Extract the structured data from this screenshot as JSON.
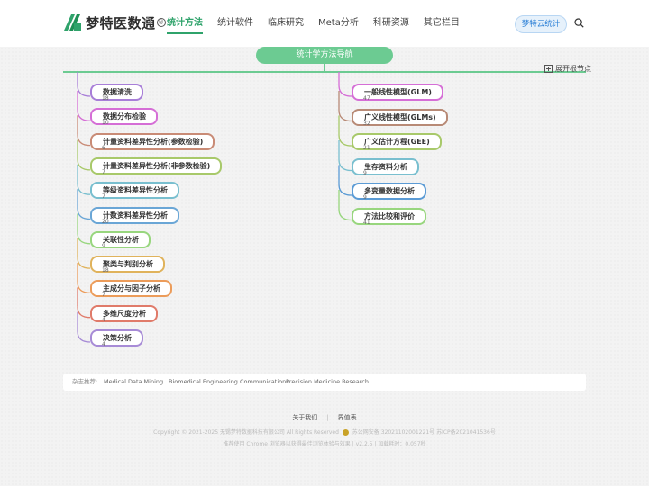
{
  "header": {
    "logo_text": "梦特医数通",
    "logo_mark": "®",
    "nav": [
      {
        "label": "统计方法",
        "active": true
      },
      {
        "label": "统计软件",
        "active": false
      },
      {
        "label": "临床研究",
        "active": false
      },
      {
        "label": "Meta分析",
        "active": false
      },
      {
        "label": "科研资源",
        "active": false
      },
      {
        "label": "其它栏目",
        "active": false
      }
    ],
    "cloud_button": "梦特云统计",
    "icons": [
      "logo-icon",
      "home-icon",
      "search-icon"
    ]
  },
  "mindmap": {
    "root": "统计学方法导航",
    "expand_label": "展开根节点",
    "left": [
      {
        "label": "数据清洗",
        "count": "18",
        "color": "#a87ed8"
      },
      {
        "label": "数据分布检验",
        "count": "10",
        "color": "#d56ed6"
      },
      {
        "label": "计量资料差异性分析(参数检验)",
        "count": "6",
        "color": "#c98b76"
      },
      {
        "label": "计量资料差异性分析(非参数检验)",
        "count": "7",
        "color": "#a8c96a"
      },
      {
        "label": "等级资料差异性分析",
        "count": "7",
        "color": "#79bfcf"
      },
      {
        "label": "计数资料差异性分析",
        "count": "20",
        "color": "#6aa6d6"
      },
      {
        "label": "关联性分析",
        "count": "9",
        "color": "#98d67e"
      },
      {
        "label": "聚类与判别分析",
        "count": "18",
        "color": "#e0b35c"
      },
      {
        "label": "主成分与因子分析",
        "count": "7",
        "color": "#ec9c5a"
      },
      {
        "label": "多维尺度分析",
        "count": "4",
        "color": "#e07b6a"
      },
      {
        "label": "决策分析",
        "count": "4",
        "color": "#a78bd6"
      }
    ],
    "right": [
      {
        "label": "一般线性模型(GLM)",
        "count": "47",
        "color": "#d56ed6"
      },
      {
        "label": "广义线性模型(GLMs)",
        "count": "32",
        "color": "#b88a76"
      },
      {
        "label": "广义估计方程(GEE)",
        "count": "21",
        "color": "#a8c96a"
      },
      {
        "label": "生存资料分析",
        "count": "9",
        "color": "#79bfcf"
      },
      {
        "label": "多变量数据分析",
        "count": "9",
        "color": "#5b9bd5"
      },
      {
        "label": "方法比较和评价",
        "count": "41",
        "color": "#98d67e"
      }
    ],
    "root_color": "#6ccb92"
  },
  "recommend": {
    "label": "杂志推荐:",
    "links": [
      "Medical Data Mining",
      "Biomedical Engineering Communications",
      "Precision Medicine Research"
    ]
  },
  "footer": {
    "links": [
      "关于我们",
      "界值表"
    ],
    "copyright": "Copyright © 2021-2025 无锡梦特数据科技有限公司 All Rights Reserved",
    "police": "苏公网安备 32021102001221号",
    "icp": "苏ICP备2021041536号",
    "browser_tip": "推荐使用 Chrome 浏览器以获得最佳浏览体验与效果",
    "version": "v2.2.5",
    "load_time": "加载耗时：0.057秒"
  }
}
